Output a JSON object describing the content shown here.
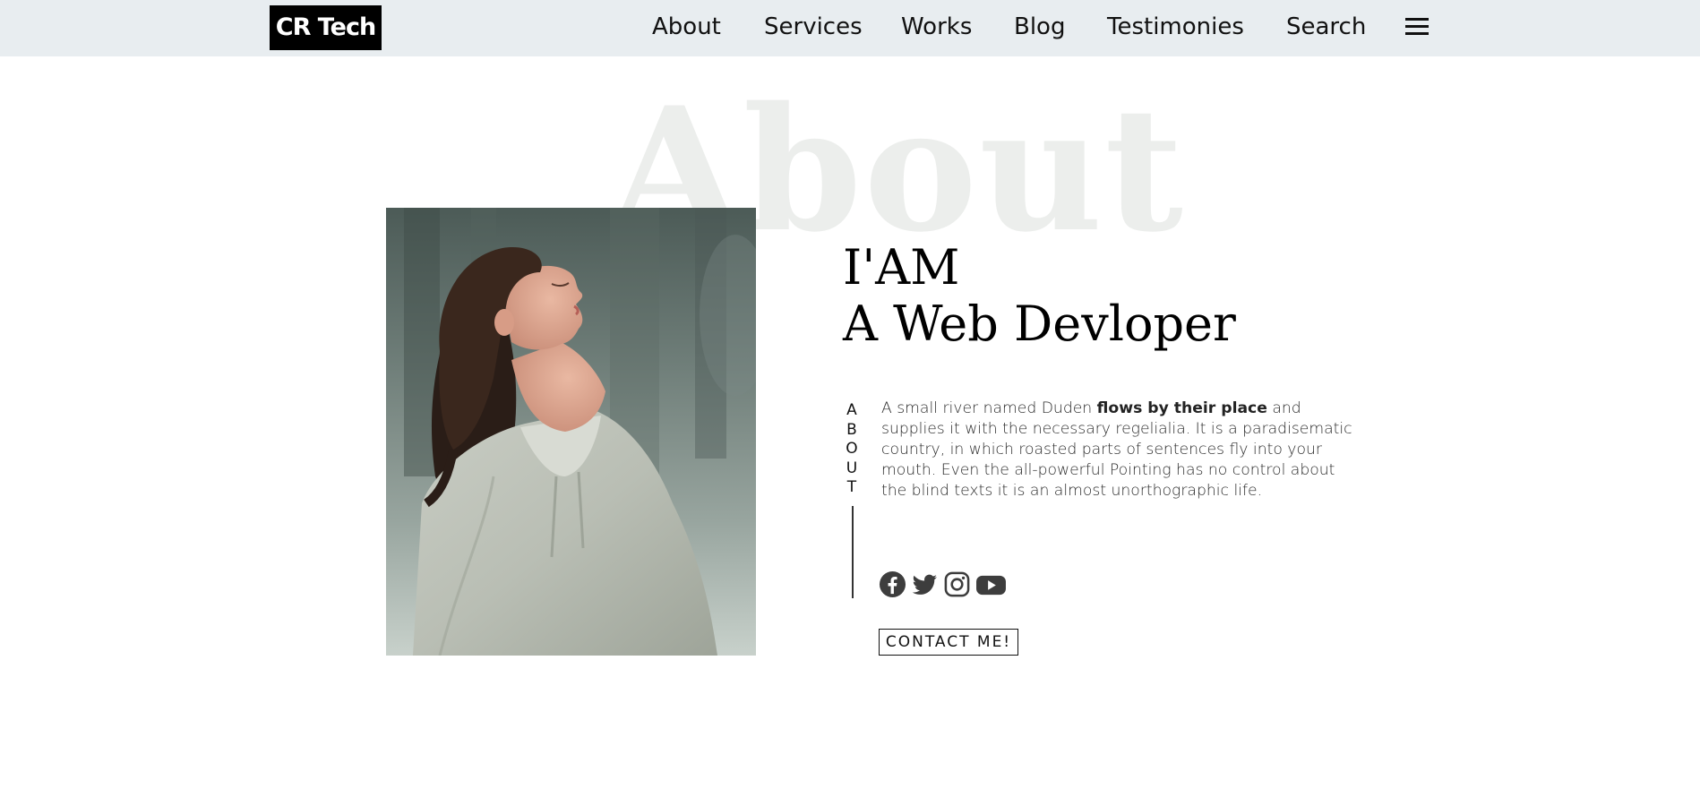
{
  "navbar": {
    "brand": "CR Tech",
    "links": [
      "About",
      "Services",
      "Works",
      "Blog",
      "Testimonies",
      "Search"
    ],
    "menu_icon": "hamburger-menu-icon",
    "background": "#e8edf0"
  },
  "hero": {
    "background_word": "About",
    "heading_line1": "I'AM",
    "heading_line2": "A Web Devloper",
    "side_label": "ABOUT",
    "description_part1": "A small river named Duden ",
    "description_bold": "flows by their place",
    "description_part2": " and supplies it with the necessary regelialia. It is a paradisematic country, in which roasted parts of sentences fly into your mouth. Even the all-powerful Pointing has no control about the blind texts it is an almost unorthographic life.",
    "social_icons": [
      "facebook-icon",
      "twitter-icon",
      "instagram-icon",
      "youtube-icon"
    ],
    "contact_button": "CONTACT ME!",
    "photo": "portrait-photo"
  }
}
